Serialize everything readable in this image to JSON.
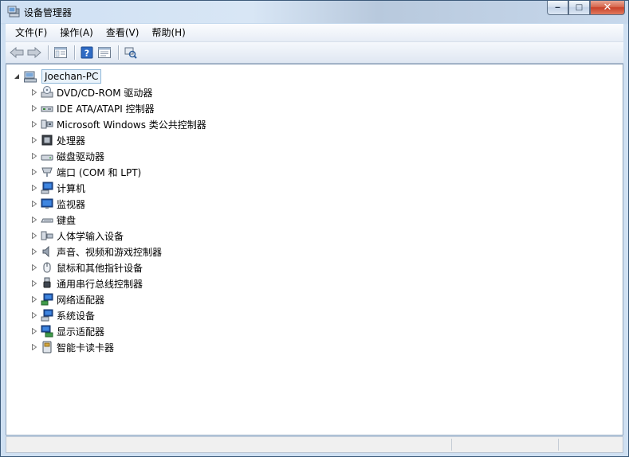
{
  "window": {
    "title": "设备管理器",
    "icon": "device-manager-icon"
  },
  "caption_buttons": {
    "minimize": "‒",
    "maximize": "□",
    "close": "✕"
  },
  "menu": [
    "文件(F)",
    "操作(A)",
    "查看(V)",
    "帮助(H)"
  ],
  "toolbar": {
    "buttons": [
      "back-arrow-icon",
      "forward-arrow-icon",
      "show-hide-console-tree-icon",
      "help-icon",
      "properties-icon",
      "scan-hardware-icon"
    ]
  },
  "tree": {
    "root": {
      "label": "Joechan-PC",
      "icon": "computer-icon",
      "expanded": true
    },
    "items": [
      {
        "label": "DVD/CD-ROM 驱动器",
        "icon": "dvd-drive-icon"
      },
      {
        "label": "IDE ATA/ATAPI 控制器",
        "icon": "ide-controller-icon"
      },
      {
        "label": "Microsoft Windows 类公共控制器",
        "icon": "usb-controller-icon"
      },
      {
        "label": "处理器",
        "icon": "processor-icon"
      },
      {
        "label": "磁盘驱动器",
        "icon": "disk-drive-icon"
      },
      {
        "label": "端口 (COM 和 LPT)",
        "icon": "port-icon"
      },
      {
        "label": "计算机",
        "icon": "computer-icon"
      },
      {
        "label": "监视器",
        "icon": "monitor-icon"
      },
      {
        "label": "键盘",
        "icon": "keyboard-icon"
      },
      {
        "label": "人体学输入设备",
        "icon": "hid-icon"
      },
      {
        "label": "声音、视频和游戏控制器",
        "icon": "speaker-icon"
      },
      {
        "label": "鼠标和其他指针设备",
        "icon": "mouse-icon"
      },
      {
        "label": "通用串行总线控制器",
        "icon": "usb-plug-icon"
      },
      {
        "label": "网络适配器",
        "icon": "network-adapter-icon"
      },
      {
        "label": "系统设备",
        "icon": "system-device-icon"
      },
      {
        "label": "显示适配器",
        "icon": "display-adapter-icon"
      },
      {
        "label": "智能卡读卡器",
        "icon": "smart-card-reader-icon"
      }
    ]
  },
  "colors": {
    "title_bar": "#c9dcf0",
    "selection_border": "#8fb7d8",
    "close_button": "#c8412a"
  }
}
